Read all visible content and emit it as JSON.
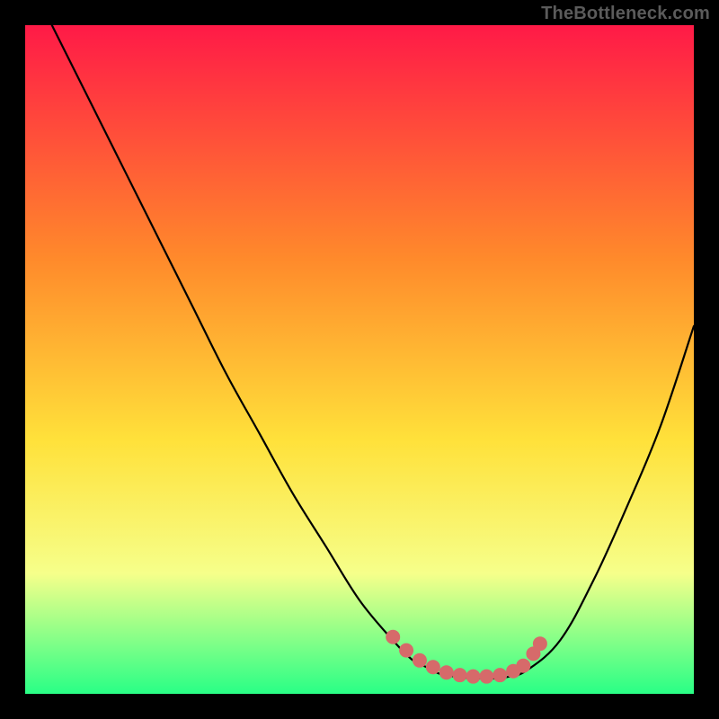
{
  "attribution": "TheBottleneck.com",
  "colors": {
    "frame": "#000000",
    "gradient_top": "#ff1a47",
    "gradient_mid1": "#ff8a2b",
    "gradient_mid2": "#ffe13a",
    "gradient_mid3": "#f6ff8a",
    "gradient_bottom": "#29ff86",
    "curve": "#000000",
    "markers": "#d66a6a"
  },
  "chart_data": {
    "type": "line",
    "title": "",
    "xlabel": "",
    "ylabel": "",
    "xlim": [
      0,
      100
    ],
    "ylim": [
      0,
      100
    ],
    "series": [
      {
        "name": "bottleneck-curve",
        "x": [
          4,
          10,
          15,
          20,
          25,
          30,
          35,
          40,
          45,
          50,
          55,
          58,
          60,
          62,
          65,
          68,
          70,
          72,
          75,
          80,
          85,
          90,
          95,
          100
        ],
        "y": [
          100,
          88,
          78,
          68,
          58,
          48,
          39,
          30,
          22,
          14,
          8,
          5,
          4,
          3,
          2.5,
          2.3,
          2.3,
          2.5,
          3.5,
          8,
          17,
          28,
          40,
          55
        ]
      }
    ],
    "annotations": [
      {
        "name": "optimum-markers",
        "type": "scatter",
        "points": [
          {
            "x": 55,
            "y": 8.5
          },
          {
            "x": 57,
            "y": 6.5
          },
          {
            "x": 59,
            "y": 5
          },
          {
            "x": 61,
            "y": 4
          },
          {
            "x": 63,
            "y": 3.2
          },
          {
            "x": 65,
            "y": 2.8
          },
          {
            "x": 67,
            "y": 2.6
          },
          {
            "x": 69,
            "y": 2.6
          },
          {
            "x": 71,
            "y": 2.8
          },
          {
            "x": 73,
            "y": 3.4
          },
          {
            "x": 74.5,
            "y": 4.2
          },
          {
            "x": 76,
            "y": 6
          },
          {
            "x": 77,
            "y": 7.5
          }
        ]
      }
    ]
  }
}
